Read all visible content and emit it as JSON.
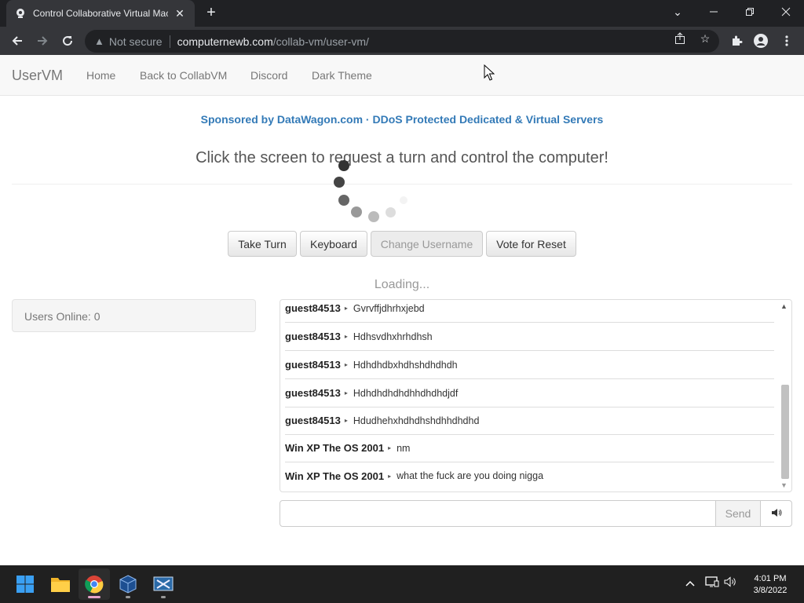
{
  "browser": {
    "tab_title": "Control Collaborative Virtual Mac",
    "security_label": "Not secure",
    "url_host": "computernewb.com",
    "url_path": "/collab-vm/user-vm/"
  },
  "navbar": {
    "brand": "UserVM",
    "links": [
      "Home",
      "Back to CollabVM",
      "Discord",
      "Dark Theme"
    ]
  },
  "sponsor_text": "Sponsored by DataWagon.com · DDoS Protected Dedicated & Virtual Servers",
  "heading": "Click the screen to request a turn and control the computer!",
  "buttons": {
    "take_turn": "Take Turn",
    "keyboard": "Keyboard",
    "change_username": "Change Username",
    "vote_reset": "Vote for Reset"
  },
  "loading": "Loading...",
  "users_online": "Users Online: 0",
  "chat": {
    "messages": [
      {
        "user": "guest84513",
        "text": "Gvrvffjdhrhxjebd"
      },
      {
        "user": "guest84513",
        "text": "Hdhsvdhxhrhdhsh"
      },
      {
        "user": "guest84513",
        "text": "Hdhdhdbxhdhshdhdhdh"
      },
      {
        "user": "guest84513",
        "text": "Hdhdhdhdhdhhdhdhdjdf"
      },
      {
        "user": "guest84513",
        "text": "Hdudhehxhdhdhshdhhdhdhd"
      },
      {
        "user": "Win XP The OS 2001",
        "text": "nm"
      },
      {
        "user": "Win XP The OS 2001",
        "text": "what the fuck are you doing nigga"
      }
    ],
    "send_label": "Send",
    "input_value": ""
  },
  "taskbar": {
    "time": "4:01 PM",
    "date": "3/8/2022",
    "apps": [
      "start-icon",
      "file-explorer-icon",
      "chrome-icon",
      "virtualbox-icon",
      "vm-app-icon"
    ]
  },
  "colors": {
    "link_blue": "#337ab7",
    "chrome_dark": "#202124",
    "chrome_tab": "#35363a"
  }
}
